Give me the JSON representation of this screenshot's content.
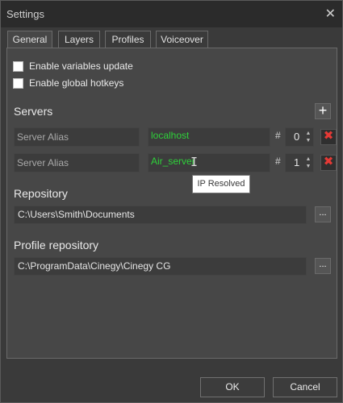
{
  "window": {
    "title": "Settings",
    "close_glyph": "✕"
  },
  "tabs": [
    {
      "label": "General",
      "active": true
    },
    {
      "label": "Layers",
      "active": false
    },
    {
      "label": "Profiles",
      "active": false
    },
    {
      "label": "Voiceover",
      "active": false
    }
  ],
  "general": {
    "checkboxes": [
      {
        "label": "Enable variables update",
        "checked": false
      },
      {
        "label": "Enable global hotkeys",
        "checked": false
      }
    ],
    "servers_title": "Servers",
    "add_glyph": "+",
    "servers": [
      {
        "alias_placeholder": "Server Alias",
        "host": "localhost",
        "hash": "#",
        "index": "0"
      },
      {
        "alias_placeholder": "Server Alias",
        "host": "Air_server",
        "hash": "#",
        "index": "1"
      }
    ],
    "spin_up": "▲",
    "spin_down": "▼",
    "delete_glyph": "✖",
    "tooltip": "IP Resolved",
    "repository_title": "Repository",
    "repository_path": "C:\\Users\\Smith\\Documents",
    "profile_repository_title": "Profile repository",
    "profile_repository_path": "C:\\ProgramData\\Cinegy\\Cinegy CG",
    "browse_label": "..."
  },
  "footer": {
    "ok_label": "OK",
    "cancel_label": "Cancel"
  },
  "colors": {
    "accent_green": "#2ed13a",
    "delete_red": "#e53935",
    "panel_bg": "#474747"
  }
}
